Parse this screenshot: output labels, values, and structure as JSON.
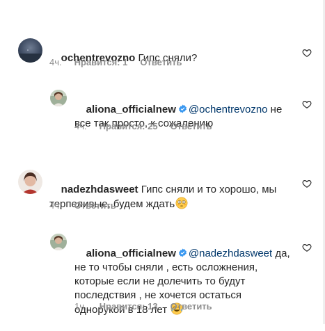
{
  "comments": [
    {
      "username": "ochentrevozno",
      "verified": false,
      "text": " Гипс сняли?",
      "time": "4ч.",
      "likes": "Нравится: 1",
      "reply": "Ответить",
      "avatar": "night-sky-avatar"
    },
    {
      "username": "aliona_officialnew",
      "verified": true,
      "mention": "@ochentrevozno",
      "text": " не все так просто, к сожалению",
      "time": "4ч.",
      "likes": "Нравится: 25",
      "reply": "Ответить",
      "avatar": "woman-photo-avatar"
    },
    {
      "username": "nadezhdasweet",
      "verified": false,
      "text": " Гипс сняли и то хорошо, мы терпеливые, будем ждать",
      "emoji": "flushed-face",
      "time": "4ч.",
      "reply": "Ответить",
      "avatar": "woman-portrait-avatar"
    },
    {
      "username": "aliona_officialnew",
      "verified": true,
      "mention": "@nadezhdasweet",
      "text": " да, не то чтобы сняли , есть осложнения, которые если не долечить то будут последствия , не хочется остаться однорукой в 18 лет ",
      "emoji": "tears-of-joy-face",
      "time": "1ч.",
      "likes": "Нравится: 13",
      "reply": "Ответить",
      "avatar": "woman-photo-avatar"
    }
  ],
  "colors": {
    "text": "#262626",
    "secondary": "#8e8e8e",
    "mention": "#00376b",
    "verified": "#3897f0"
  },
  "icons": {
    "like": "heart-outline-icon",
    "verified": "verified-badge-icon"
  }
}
